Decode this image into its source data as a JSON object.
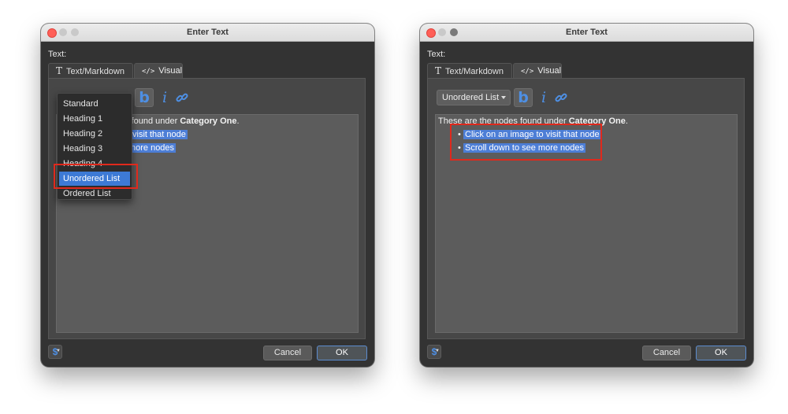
{
  "windows": [
    {
      "title": "Enter Text",
      "text_label": "Text:",
      "tabs": [
        {
          "label": "Text/Markdown",
          "icon": "T"
        },
        {
          "label": "Visual",
          "icon": "</>"
        }
      ],
      "toolbar": {
        "bold_glyph": "b",
        "italic_glyph": "i"
      },
      "editor": {
        "intro_prefix": "s found under ",
        "intro_bold": "Category One",
        "intro_suffix": ".",
        "bullets": [
          "visit that node",
          "nore nodes"
        ]
      },
      "dropdown": {
        "items": [
          "Standard",
          "Heading 1",
          "Heading 2",
          "Heading 3",
          "Heading 4",
          "Unordered List",
          "Ordered List"
        ],
        "selected": "Unordered List"
      },
      "buttons": {
        "dollar": "$",
        "cancel": "Cancel",
        "ok": "OK"
      }
    },
    {
      "title": "Enter Text",
      "text_label": "Text:",
      "tabs": [
        {
          "label": "Text/Markdown",
          "icon": "T"
        },
        {
          "label": "Visual",
          "icon": "</>"
        }
      ],
      "toolbar": {
        "format_select": "Unordered List",
        "bold_glyph": "b",
        "italic_glyph": "i"
      },
      "editor": {
        "intro_prefix": "These are the nodes found under ",
        "intro_bold": "Category One",
        "intro_suffix": ".",
        "bullet_glyph": "•",
        "bullets": [
          "Click on an image to visit that node",
          "Scroll down to see more nodes"
        ]
      },
      "buttons": {
        "dollar": "$",
        "cancel": "Cancel",
        "ok": "OK"
      }
    }
  ],
  "colors": {
    "highlight_box": "#e0291c",
    "selection": "#4d7ed6",
    "accent": "#4e8fe3"
  }
}
